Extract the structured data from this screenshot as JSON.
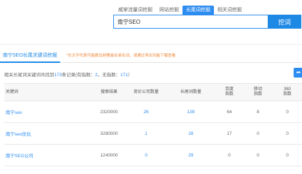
{
  "tabs": [
    {
      "label": "威掌流量词挖掘"
    },
    {
      "label": "网站挖掘"
    },
    {
      "label": "长尾词挖掘",
      "active": true
    },
    {
      "label": "相关词挖掘"
    }
  ],
  "search": {
    "value": "南宁SEO",
    "button_label": "挖词"
  },
  "section": {
    "title": "南宁SEO长尾关键词挖掘",
    "note": "*长文字代表可能数及网警最名单名词，请通过导出功能下载查看"
  },
  "summary": {
    "prefix": "相关长尾词关键词共找到",
    "count": "173",
    "mid": "条记录(有指数：",
    "with_index": "2",
    "mid2": "，无指数：",
    "no_index": "171",
    "suffix": "）"
  },
  "table": {
    "headers": [
      "关键词",
      "搜索结果",
      "竞价公司数量",
      "长尾词数量",
      "百度\n指数",
      "移动\n指数",
      "360\n指数"
    ],
    "rows": [
      [
        "南宁seo",
        "2320000",
        "26",
        "139",
        "64",
        "8",
        "0"
      ],
      [
        "南宁seo优化",
        "3280000",
        "1",
        "28",
        "17",
        "0",
        "0"
      ],
      [
        "南宁SEO公司",
        "1240000",
        "0",
        "29",
        "0",
        "0",
        "0"
      ]
    ]
  },
  "colors": {
    "accent": "#1e88e5",
    "note": "#f0883a"
  },
  "icons": {
    "share": "share-icon"
  }
}
